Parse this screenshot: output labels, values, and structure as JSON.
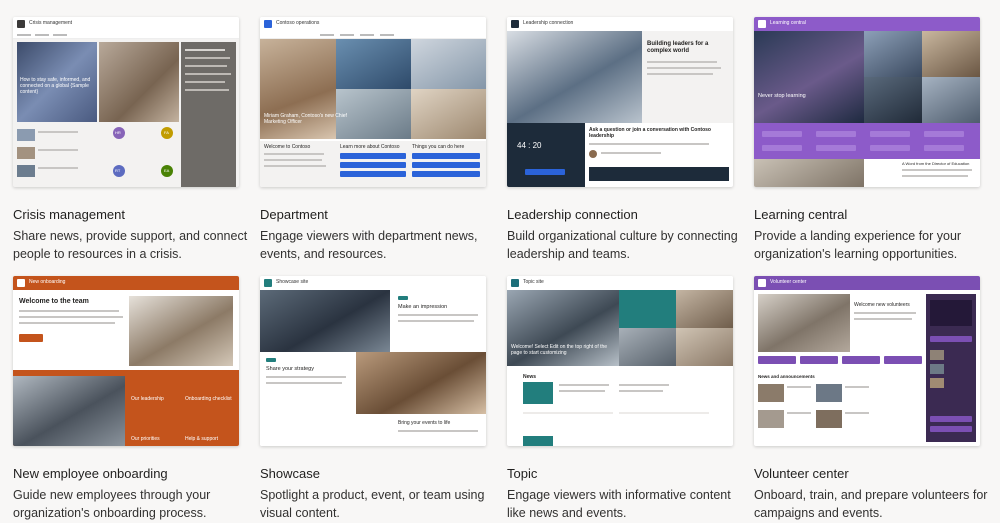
{
  "templates": [
    {
      "title": "Crisis management",
      "description": "Share news, provide support, and connect people to resources in a crisis.",
      "thumb": {
        "site_title": "Crisis management",
        "hero_caption": "How to stay safe, informed, and connected on a global {Sample content}",
        "people": [
          "HR",
          "FA",
          "RT",
          "EA"
        ]
      }
    },
    {
      "title": "Department",
      "description": "Engage viewers with department news, events, and resources.",
      "thumb": {
        "site_title": "Contoso operations",
        "hero_caption": "Miriam Graham, Contoso's new Chief Marketing Officer",
        "sections": [
          "Welcome to Contoso",
          "Learn more about Contoso",
          "Things you can do here"
        ]
      }
    },
    {
      "title": "Leadership connection",
      "description": "Build organizational culture by connecting leadership and teams.",
      "thumb": {
        "site_title": "Leadership connection",
        "hero_caption": "Building leaders for a complex world",
        "clock": "44 : 20",
        "prompt": "Ask a question or join a conversation with Contoso leadership"
      }
    },
    {
      "title": "Learning central",
      "description": "Provide a landing experience for your organization's learning opportunities.",
      "thumb": {
        "site_title": "Learning central",
        "hero_caption": "Never stop learning",
        "section": "A Word from the Director of Education"
      }
    },
    {
      "title": "New employee onboarding",
      "description": "Guide new employees through your organization's onboarding process.",
      "thumb": {
        "site_title": "New onboarding",
        "hero_caption": "Welcome to the team",
        "links": [
          "Our leadership",
          "Onboarding checklist",
          "Our priorities",
          "Help & support"
        ]
      }
    },
    {
      "title": "Showcase",
      "description": "Spotlight a product, event, or team using visual content.",
      "thumb": {
        "site_title": "Showcase site",
        "items": [
          "Make an impression",
          "Share your strategy",
          "Bring your events to life"
        ]
      }
    },
    {
      "title": "Topic",
      "description": "Engage viewers with informative content like news and events.",
      "thumb": {
        "site_title": "Topic site",
        "hero_caption": "Welcome! Select Edit on the top right of the page to start customizing",
        "section": "News"
      }
    },
    {
      "title": "Volunteer center",
      "description": "Onboard, train, and prepare volunteers for campaigns and events.",
      "thumb": {
        "site_title": "Volunteer center",
        "hero_caption": "Welcome new volunteers",
        "section": "News and announcements"
      }
    }
  ],
  "colors": {
    "crisis": "#6e6b67",
    "department": "#2b63d9",
    "leadership": "#1d2b3a",
    "learning": "#8d5bc9",
    "onboarding": "#c4541c",
    "showcase": "#227e7d",
    "topic": "#1d6f7a",
    "volunteer": "#7b4fb3"
  }
}
